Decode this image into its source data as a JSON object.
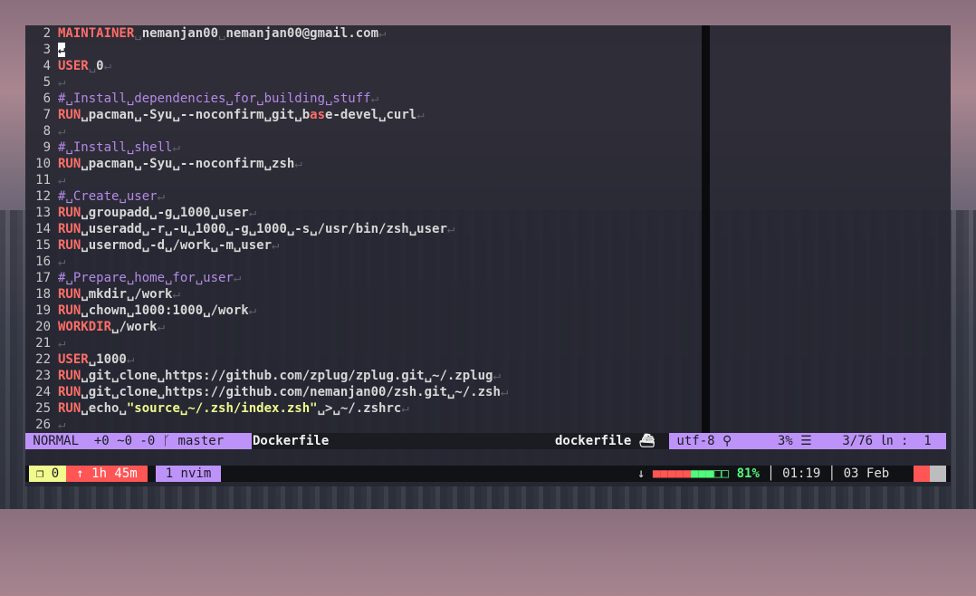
{
  "editor": {
    "lines": [
      {
        "n": "2",
        "segs": [
          {
            "t": "MAINTAINER",
            "c": "kw"
          },
          {
            "t": "␣",
            "c": "sp"
          },
          {
            "t": "nemanjan00",
            "c": "tx"
          },
          {
            "t": "␣",
            "c": "sp"
          },
          {
            "t": "nemanjan00@gmail.com",
            "c": "tx"
          },
          {
            "t": "↵",
            "c": "nl"
          }
        ]
      },
      {
        "n": "3",
        "segs": [
          {
            "t": "↵",
            "c": "cursor"
          }
        ]
      },
      {
        "n": "4",
        "segs": [
          {
            "t": "USER",
            "c": "kw"
          },
          {
            "t": "␣",
            "c": "sp"
          },
          {
            "t": "0",
            "c": "tx"
          },
          {
            "t": "↵",
            "c": "nl"
          }
        ]
      },
      {
        "n": "5",
        "segs": [
          {
            "t": "↵",
            "c": "nl"
          }
        ]
      },
      {
        "n": "6",
        "segs": [
          {
            "t": "#␣Install␣dependencies␣for␣building␣stuff",
            "c": "cm"
          },
          {
            "t": "↵",
            "c": "nl"
          }
        ]
      },
      {
        "n": "7",
        "segs": [
          {
            "t": "RUN",
            "c": "kw"
          },
          {
            "t": "␣pacman␣-Syu␣--noconfirm␣git␣b",
            "c": "tx"
          },
          {
            "t": "as",
            "c": "kw"
          },
          {
            "t": "e-devel␣curl",
            "c": "tx"
          },
          {
            "t": "↵",
            "c": "nl"
          }
        ]
      },
      {
        "n": "8",
        "segs": [
          {
            "t": "↵",
            "c": "nl"
          }
        ]
      },
      {
        "n": "9",
        "segs": [
          {
            "t": "#␣Install␣shell",
            "c": "cm"
          },
          {
            "t": "↵",
            "c": "nl"
          }
        ]
      },
      {
        "n": "10",
        "segs": [
          {
            "t": "RUN",
            "c": "kw"
          },
          {
            "t": "␣pacman␣-Syu␣--noconfirm␣zsh",
            "c": "tx"
          },
          {
            "t": "↵",
            "c": "nl"
          }
        ]
      },
      {
        "n": "11",
        "segs": [
          {
            "t": "↵",
            "c": "nl"
          }
        ]
      },
      {
        "n": "12",
        "segs": [
          {
            "t": "#␣Create␣user",
            "c": "cm"
          },
          {
            "t": "↵",
            "c": "nl"
          }
        ]
      },
      {
        "n": "13",
        "segs": [
          {
            "t": "RUN",
            "c": "kw"
          },
          {
            "t": "␣groupadd␣-g␣1000␣user",
            "c": "tx"
          },
          {
            "t": "↵",
            "c": "nl"
          }
        ]
      },
      {
        "n": "14",
        "segs": [
          {
            "t": "RUN",
            "c": "kw"
          },
          {
            "t": "␣useradd␣-r␣-u␣1000␣-g␣1000␣-s␣/usr/bin/zsh␣user",
            "c": "tx"
          },
          {
            "t": "↵",
            "c": "nl"
          }
        ]
      },
      {
        "n": "15",
        "segs": [
          {
            "t": "RUN",
            "c": "kw"
          },
          {
            "t": "␣usermod␣-d␣/work␣-m␣user",
            "c": "tx"
          },
          {
            "t": "↵",
            "c": "nl"
          }
        ]
      },
      {
        "n": "16",
        "segs": [
          {
            "t": "↵",
            "c": "nl"
          }
        ]
      },
      {
        "n": "17",
        "segs": [
          {
            "t": "#␣Prepare␣home␣for␣user",
            "c": "cm"
          },
          {
            "t": "↵",
            "c": "nl"
          }
        ]
      },
      {
        "n": "18",
        "segs": [
          {
            "t": "RUN",
            "c": "kw"
          },
          {
            "t": "␣mkdir␣/work",
            "c": "tx"
          },
          {
            "t": "↵",
            "c": "nl"
          }
        ]
      },
      {
        "n": "19",
        "segs": [
          {
            "t": "RUN",
            "c": "kw"
          },
          {
            "t": "␣chown␣1000:1000␣/work",
            "c": "tx"
          },
          {
            "t": "↵",
            "c": "nl"
          }
        ]
      },
      {
        "n": "20",
        "segs": [
          {
            "t": "WORKDIR",
            "c": "kw"
          },
          {
            "t": "␣/work",
            "c": "tx"
          },
          {
            "t": "↵",
            "c": "nl"
          }
        ]
      },
      {
        "n": "21",
        "segs": [
          {
            "t": "↵",
            "c": "nl"
          }
        ]
      },
      {
        "n": "22",
        "segs": [
          {
            "t": "USER",
            "c": "kw"
          },
          {
            "t": "␣1000",
            "c": "tx"
          },
          {
            "t": "↵",
            "c": "nl"
          }
        ]
      },
      {
        "n": "23",
        "segs": [
          {
            "t": "RUN",
            "c": "kw"
          },
          {
            "t": "␣git␣clone␣https://github.com/zplug/zplug.git␣~/.zplug",
            "c": "tx"
          },
          {
            "t": "↵",
            "c": "nl"
          }
        ]
      },
      {
        "n": "24",
        "segs": [
          {
            "t": "RUN",
            "c": "kw"
          },
          {
            "t": "␣git␣clone␣https://github.com/nemanjan00/zsh.git␣~/.zsh",
            "c": "tx"
          },
          {
            "t": "↵",
            "c": "nl"
          }
        ]
      },
      {
        "n": "25",
        "segs": [
          {
            "t": "RUN",
            "c": "kw"
          },
          {
            "t": "␣echo␣",
            "c": "tx"
          },
          {
            "t": "\"source␣~/.zsh/index.zsh\"",
            "c": "str"
          },
          {
            "t": "␣>␣~/.zshrc",
            "c": "tx"
          },
          {
            "t": "↵",
            "c": "nl"
          }
        ]
      },
      {
        "n": "26",
        "segs": [
          {
            "t": "↵",
            "c": "nl"
          }
        ]
      }
    ]
  },
  "statusline": {
    "mode": " NORMAL  +0 ~0 -0 ᚴ master",
    "filename": "Dockerfile",
    "filetype": "dockerfile ⛴",
    "right": " utf-8 ⚲      3% ☰    3/76 ㏑ :  1"
  },
  "tmux": {
    "session": "❐ 0",
    "uptime": "↑ 1h 45m",
    "window": "1 nvim",
    "battery_arrow": "↓ ",
    "battery_red": "■■■■■",
    "battery_green": "■■■",
    "battery_empty": "□□",
    "battery_pct": " 81%",
    "clock": " │ 01:19 │ 03 Feb"
  },
  "colors": {
    "accent": "#bd93f9",
    "keyword": "#ff6e67",
    "comment": "#b48ae6",
    "string": "#f1fa8c",
    "battery_good": "#50fa7b"
  }
}
